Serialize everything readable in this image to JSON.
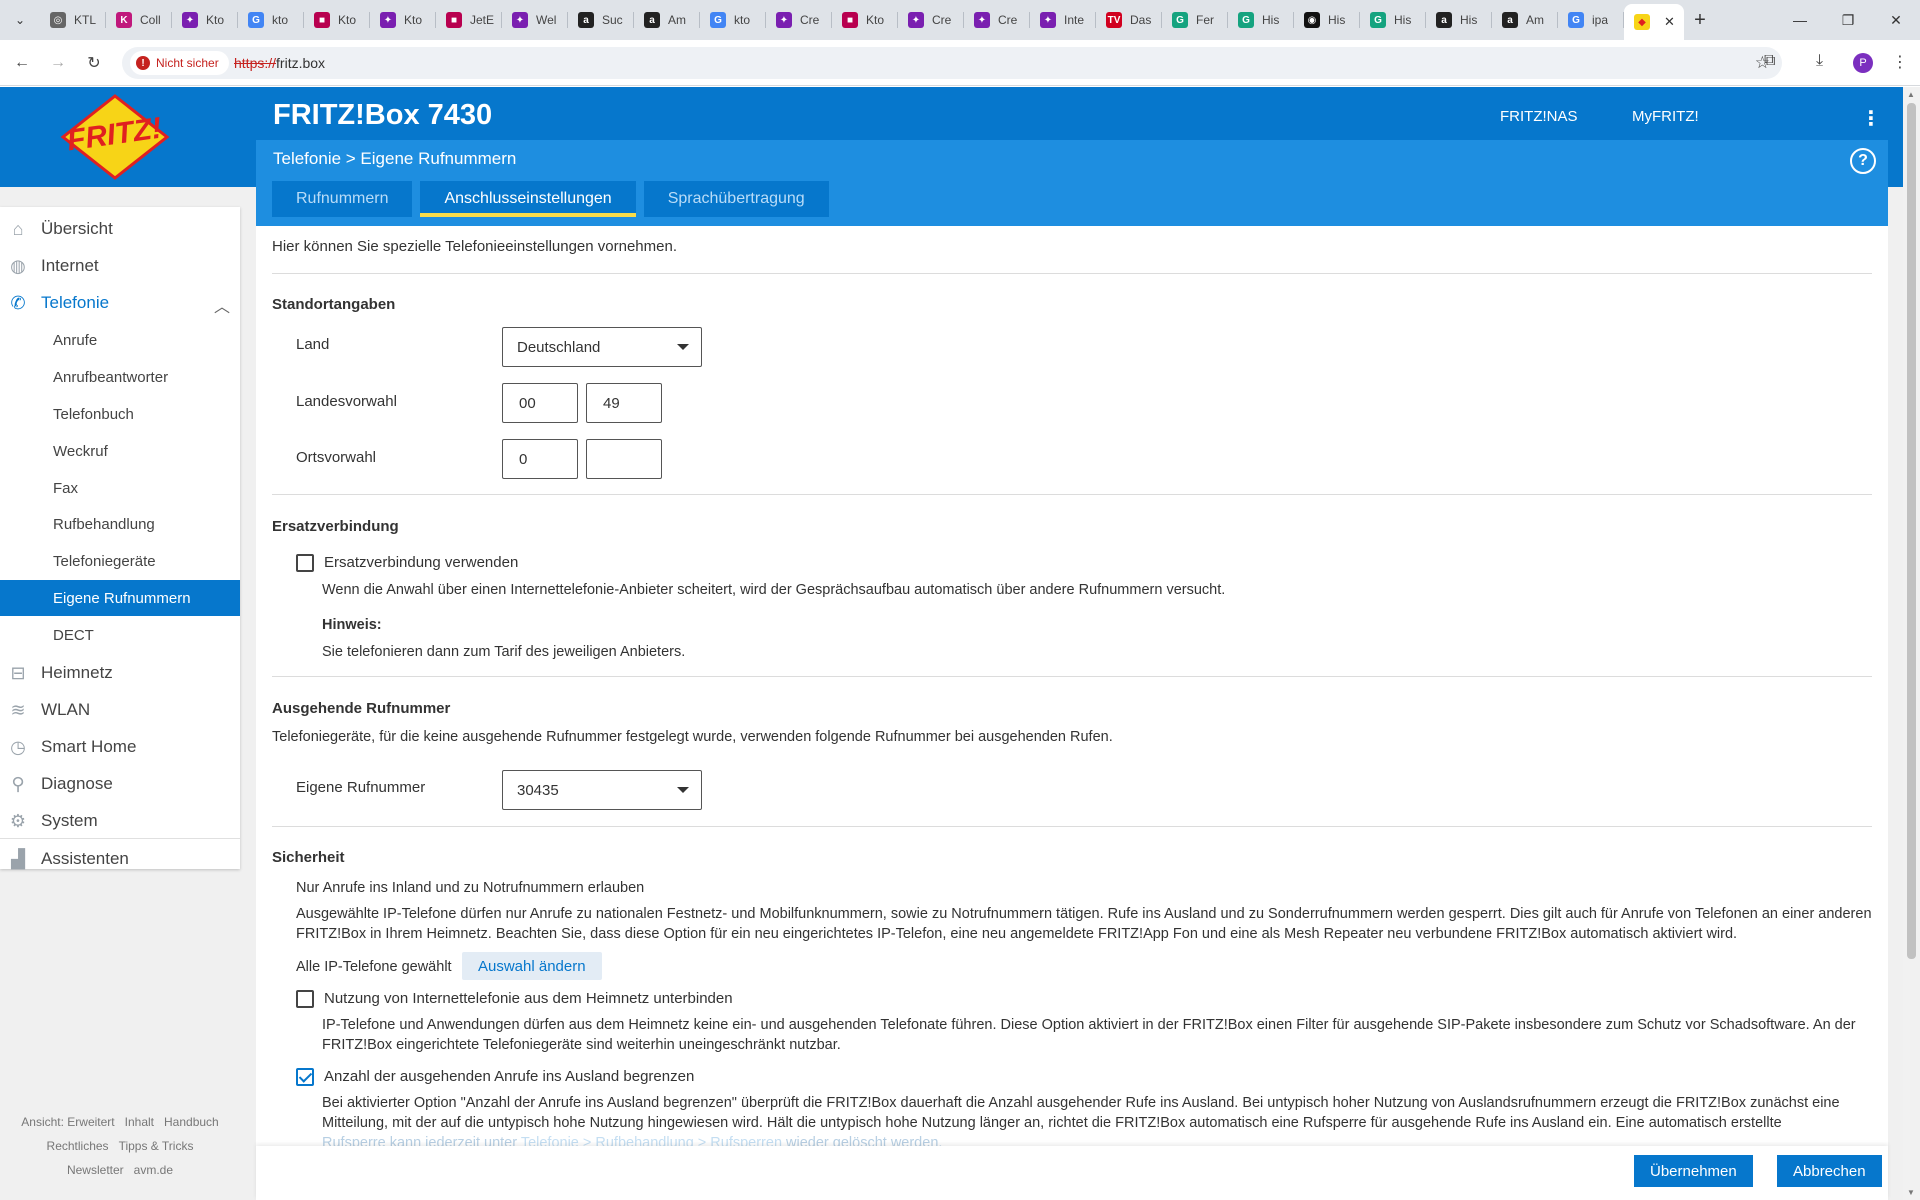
{
  "browser": {
    "tabs": [
      {
        "title": "KTL",
        "icon": "globe-icon",
        "color": "#666666",
        "glyph": "◎"
      },
      {
        "title": "Coll",
        "icon": "k-icon",
        "color": "#c0187c",
        "glyph": "K"
      },
      {
        "title": "Kto",
        "icon": "wand-icon",
        "color": "#7a1fb0",
        "glyph": "✦"
      },
      {
        "title": "kto",
        "icon": "google-icon",
        "color": "#4285f4",
        "glyph": "G"
      },
      {
        "title": "Kto",
        "icon": "app-icon",
        "color": "#b8004f",
        "glyph": "■"
      },
      {
        "title": "Kto",
        "icon": "wand-icon",
        "color": "#7a1fb0",
        "glyph": "✦"
      },
      {
        "title": "JetE",
        "icon": "app-icon",
        "color": "#b8004f",
        "glyph": "■"
      },
      {
        "title": "Wel",
        "icon": "wand-icon",
        "color": "#7a1fb0",
        "glyph": "✦"
      },
      {
        "title": "Suc",
        "icon": "amazon-icon",
        "color": "#222222",
        "glyph": "a"
      },
      {
        "title": "Am",
        "icon": "amazon-icon",
        "color": "#222222",
        "glyph": "a"
      },
      {
        "title": "kto",
        "icon": "google-icon",
        "color": "#4285f4",
        "glyph": "G"
      },
      {
        "title": "Cre",
        "icon": "wand-icon",
        "color": "#7a1fb0",
        "glyph": "✦"
      },
      {
        "title": "Kto",
        "icon": "app-icon",
        "color": "#b8004f",
        "glyph": "■"
      },
      {
        "title": "Cre",
        "icon": "wand-icon",
        "color": "#7a1fb0",
        "glyph": "✦"
      },
      {
        "title": "Cre",
        "icon": "wand-icon",
        "color": "#7a1fb0",
        "glyph": "✦"
      },
      {
        "title": "Inte",
        "icon": "wand-icon",
        "color": "#7a1fb0",
        "glyph": "✦"
      },
      {
        "title": "Das",
        "icon": "tv-icon",
        "color": "#d1001f",
        "glyph": "TV"
      },
      {
        "title": "Fer",
        "icon": "grammarly-icon",
        "color": "#15a37f",
        "glyph": "G"
      },
      {
        "title": "His",
        "icon": "grammarly-icon",
        "color": "#15a37f",
        "glyph": "G"
      },
      {
        "title": "His",
        "icon": "chatgpt-icon",
        "color": "#111111",
        "glyph": "◉"
      },
      {
        "title": "His",
        "icon": "grammarly-icon",
        "color": "#15a37f",
        "glyph": "G"
      },
      {
        "title": "His",
        "icon": "amazon-icon",
        "color": "#222222",
        "glyph": "a"
      },
      {
        "title": "Am",
        "icon": "amazon-icon",
        "color": "#222222",
        "glyph": "a"
      },
      {
        "title": "ipa",
        "icon": "google-icon",
        "color": "#4285f4",
        "glyph": "G"
      }
    ],
    "active_tab_icon": "fritz-icon",
    "security_label": "Nicht sicher",
    "url_scheme": "https://",
    "url_rest": "fritz.box",
    "profile_initial": "P"
  },
  "header": {
    "product": "FRITZ!Box 7430",
    "links": [
      "FRITZ!NAS",
      "MyFRITZ!"
    ],
    "breadcrumb": "Telefonie > Eigene Rufnummern",
    "help": "?"
  },
  "tabs": [
    "Rufnummern",
    "Anschlusseinstellungen",
    "Sprachübertragung"
  ],
  "sidebar": {
    "main": [
      {
        "label": "Übersicht",
        "icon": "home-icon"
      },
      {
        "label": "Internet",
        "icon": "globe-icon"
      },
      {
        "label": "Telefonie",
        "icon": "phone-icon"
      },
      {
        "label": "Heimnetz",
        "icon": "network-icon"
      },
      {
        "label": "WLAN",
        "icon": "wifi-icon"
      },
      {
        "label": "Smart Home",
        "icon": "smarthome-icon"
      },
      {
        "label": "Diagnose",
        "icon": "diagnose-icon"
      },
      {
        "label": "System",
        "icon": "system-icon"
      },
      {
        "label": "Assistenten",
        "icon": "wizard-icon"
      }
    ],
    "sub": [
      "Anrufe",
      "Anrufbeantworter",
      "Telefonbuch",
      "Weckruf",
      "Fax",
      "Rufbehandlung",
      "Telefoniegeräte",
      "Eigene Rufnummern",
      "DECT"
    ],
    "footer": [
      "Ansicht: Erweitert",
      "Inhalt",
      "Handbuch",
      "Rechtliches",
      "Tipps & Tricks",
      "Newsletter",
      "avm.de"
    ]
  },
  "main": {
    "intro": "Hier können Sie spezielle Telefonieeinstellungen vornehmen.",
    "standort": {
      "title": "Standortangaben",
      "land_label": "Land",
      "land_value": "Deutschland",
      "landesvorwahl_label": "Landesvorwahl",
      "landesvorwahl_prefix": "00",
      "landesvorwahl_code": "49",
      "ortsvorwahl_label": "Ortsvorwahl",
      "ortsvorwahl_prefix": "0",
      "ortsvorwahl_code": ""
    },
    "ersatz": {
      "title": "Ersatzverbindung",
      "checkbox_label": "Ersatzverbindung verwenden",
      "checked": false,
      "desc": "Wenn die Anwahl über einen Internettelefonie-Anbieter scheitert, wird der Gesprächsaufbau automatisch über andere Rufnummern versucht.",
      "hint_title": "Hinweis:",
      "hint": "Sie telefonieren dann zum Tarif des jeweiligen Anbieters."
    },
    "ausgehend": {
      "title": "Ausgehende Rufnummer",
      "desc": "Telefoniegeräte, für die keine ausgehende Rufnummer festgelegt wurde, verwenden folgende Rufnummer bei ausgehenden Rufen.",
      "label": "Eigene Rufnummer",
      "value": "30435"
    },
    "sicherheit": {
      "title": "Sicherheit",
      "inland_title": "Nur Anrufe ins Inland und zu Notrufnummern erlauben",
      "inland_desc": "Ausgewählte IP-Telefone dürfen nur Anrufe zu nationalen Festnetz- und Mobilfunknummern, sowie zu Notrufnummern tätigen. Rufe ins Ausland und zu Sonderrufnummern werden gesperrt. Dies gilt auch für Anrufe von Telefonen an einer anderen FRITZ!Box in Ihrem Heimnetz. Beachten Sie, dass diese Option für ein neu eingerichtetes IP-Telefon, eine neu angemeldete FRITZ!App Fon und eine als Mesh Repeater neu verbundene FRITZ!Box automatisch aktiviert wird.",
      "selection_text": "Alle IP-Telefone gewählt",
      "selection_button": "Auswahl ändern",
      "block_label": "Nutzung von Internettelefonie aus dem Heimnetz unterbinden",
      "block_checked": false,
      "block_desc": "IP-Telefone und Anwendungen dürfen aus dem Heimnetz keine ein- und ausgehenden Telefonate führen. Diese Option aktiviert in der FRITZ!Box einen Filter für ausgehende SIP-Pakete insbesondere zum Schutz vor Schadsoftware. An der FRITZ!Box eingerichtete Telefoniegeräte sind weiterhin uneingeschränkt nutzbar.",
      "limit_label": "Anzahl der ausgehenden Anrufe ins Ausland begrenzen",
      "limit_checked": true,
      "limit_desc": "Bei aktivierter Option \"Anzahl der Anrufe ins Ausland begrenzen\" überprüft die FRITZ!Box dauerhaft die Anzahl ausgehender Rufe ins Ausland. Bei untypisch hoher Nutzung von Auslandsrufnummern erzeugt die FRITZ!Box zunächst eine Mitteilung, mit der auf die untypisch hohe Nutzung hingewiesen wird. Hält die untypisch hohe Nutzung länger an, richtet die FRITZ!Box automatisch eine Rufsperre für ausgehende Rufe ins Ausland ein. Eine automatisch erstellte",
      "limit_desc_tail_pre": "Rufsperre kann jederzeit unter ",
      "limit_desc_link": "Telefonie > Rufbehandlung > Rufsperren",
      "limit_desc_tail_post": " wieder gelöscht werden."
    }
  },
  "buttons": {
    "apply": "Übernehmen",
    "cancel": "Abbrechen"
  }
}
